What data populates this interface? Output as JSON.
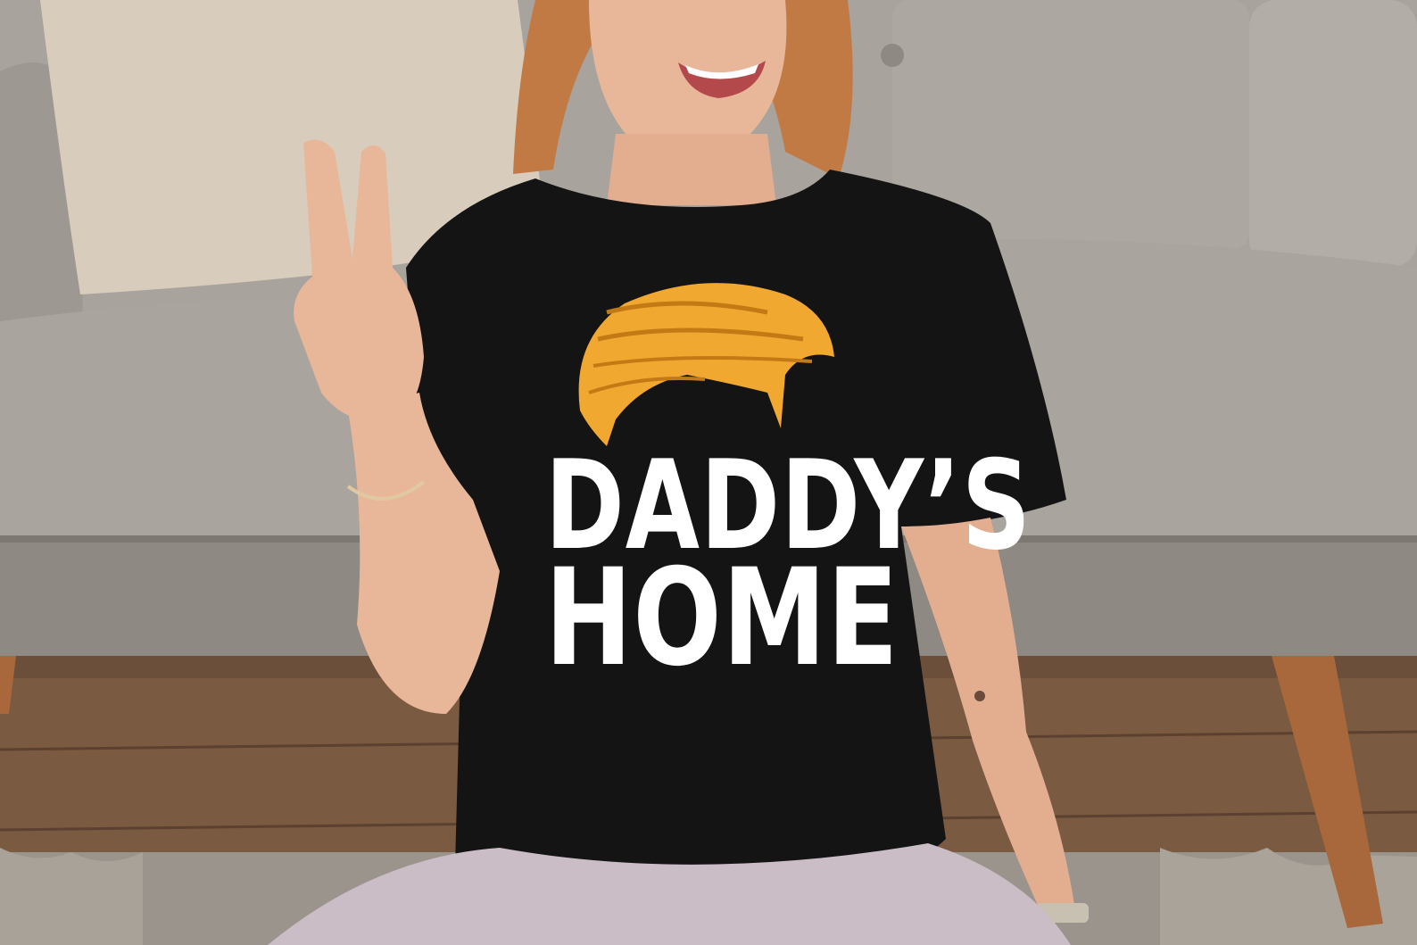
{
  "photo": {
    "subject": "person-in-tshirt",
    "shirt_print": {
      "line1": "DADDY’S",
      "line2": "HOME"
    }
  },
  "colors": {
    "floor": "#6b4f3a",
    "sofa": "#a8a39d",
    "sofa_dark": "#8e8983",
    "cushion": "#d8ccbc",
    "shirt": "#141414",
    "print_text": "#ffffff",
    "print_hair": "#f0a830",
    "skin": "#e8b79a",
    "hair": "#c27a45",
    "pants": "#cbbdc6",
    "rug": "#9a948c",
    "sofa_leg": "#a9683b"
  }
}
